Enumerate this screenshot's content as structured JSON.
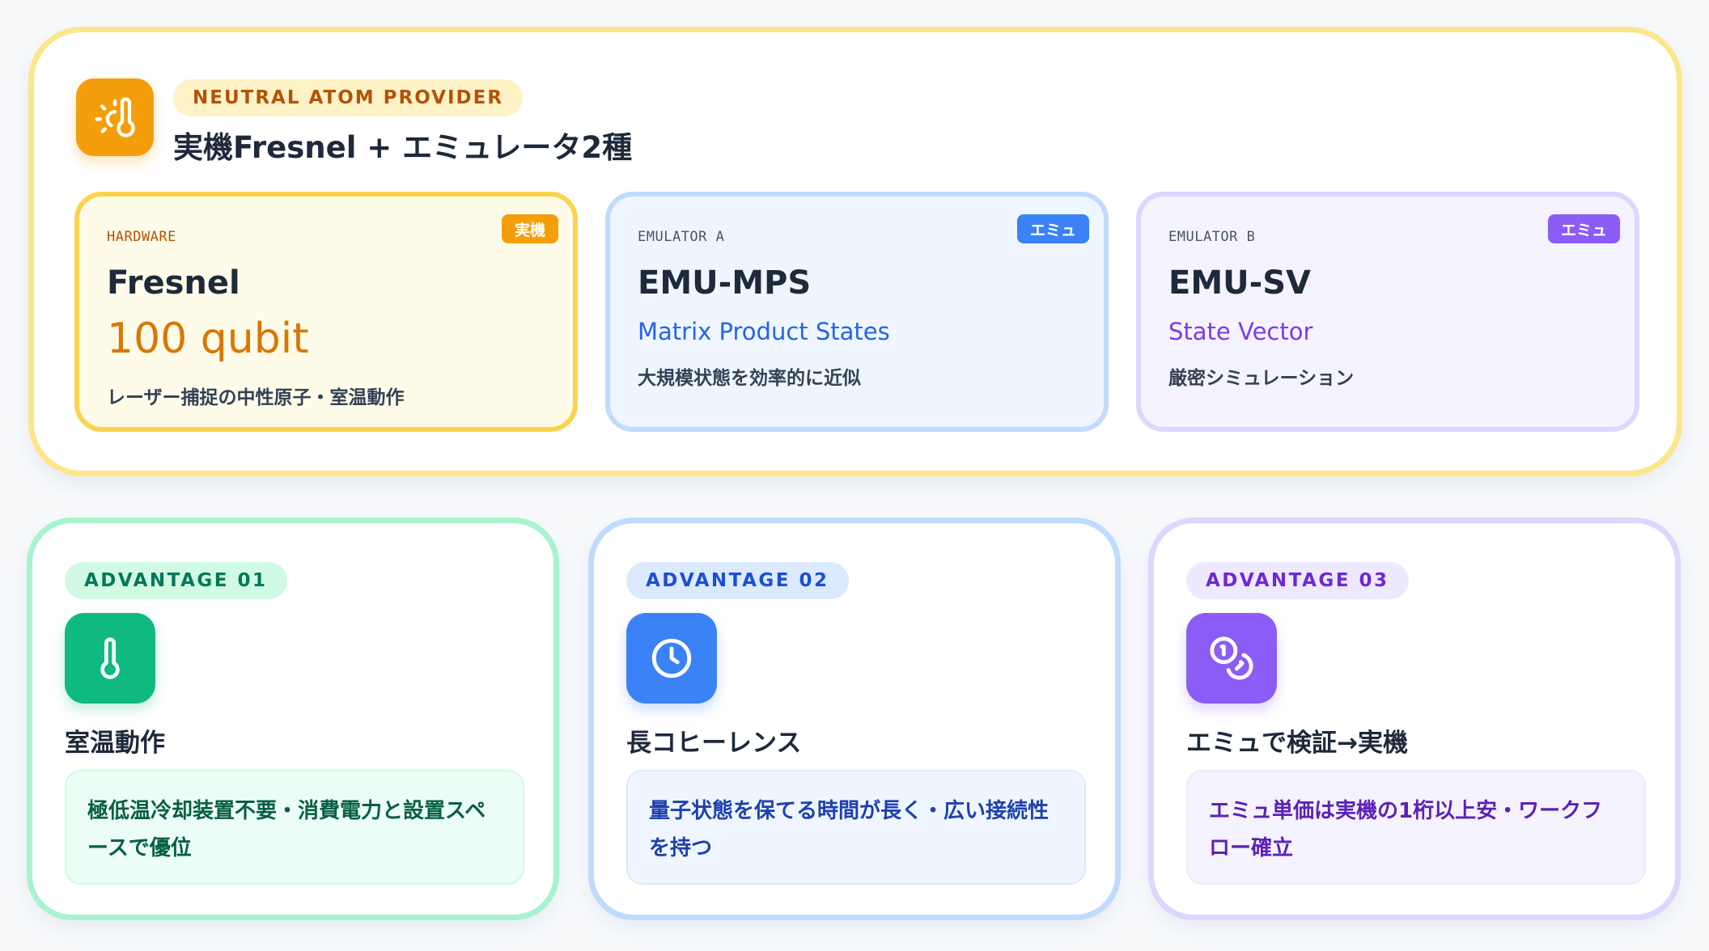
{
  "provider": {
    "badge": "NEUTRAL ATOM PROVIDER",
    "title": "実機Fresnel + エミュレータ2種",
    "icon": "sun-thermometer-icon",
    "accent": "#f59e0b"
  },
  "systems": [
    {
      "kicker": "HARDWARE",
      "tag": "実機",
      "name": "Fresnel",
      "metric": "100 qubit",
      "desc": "レーザー捕捉の中性原子・室温動作",
      "color": "#f59e0b"
    },
    {
      "kicker": "EMULATOR A",
      "tag": "エミュ",
      "name": "EMU-MPS",
      "subtitle": "Matrix Product States",
      "desc": "大規模状態を効率的に近似",
      "color": "#3b82f6"
    },
    {
      "kicker": "EMULATOR B",
      "tag": "エミュ",
      "name": "EMU-SV",
      "subtitle": "State Vector",
      "desc": "厳密シミュレーション",
      "color": "#8b5cf6"
    }
  ],
  "advantages": [
    {
      "label": "ADVANTAGE 01",
      "icon": "thermometer-icon",
      "title": "室温動作",
      "body": "極低温冷却装置不要・消費電力と設置スペースで優位",
      "color": "#10b981"
    },
    {
      "label": "ADVANTAGE 02",
      "icon": "clock-icon",
      "title": "長コヒーレンス",
      "body": "量子状態を保てる時間が長く・広い接続性を持つ",
      "color": "#3b82f6"
    },
    {
      "label": "ADVANTAGE 03",
      "icon": "coins-icon",
      "title": "エミュで検証→実機",
      "body": "エミュ単価は実機の1桁以上安・ワークフロー確立",
      "color": "#8b5cf6"
    }
  ]
}
